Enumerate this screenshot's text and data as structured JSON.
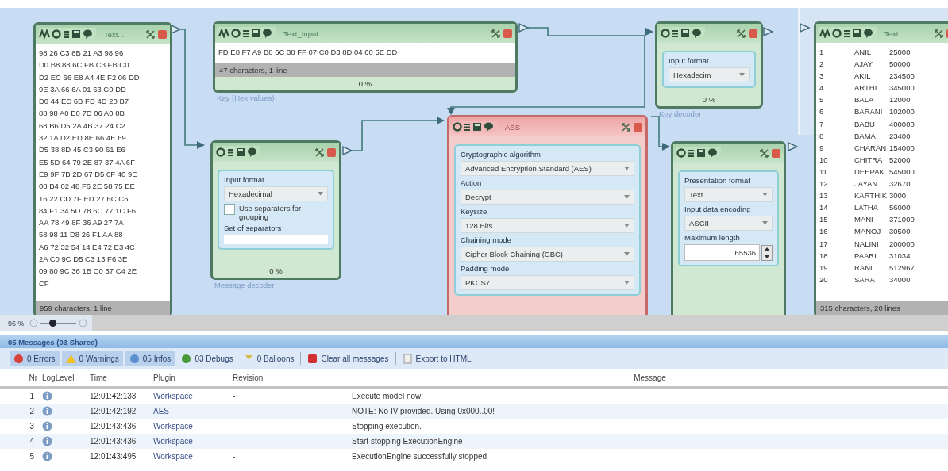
{
  "canvas": {
    "nodes": [
      {
        "kind": "text_box",
        "title": "Text...",
        "lines": [
          "98 26 C3 8B 21 A3 98 96",
          "D0 B8 88 6C FB C3 FB C0",
          "D2 EC 66 E8 A4 4E F2 06 DD",
          "9E 3A 66 6A 01 63 C0 DD",
          "D0 44 EC 6B FD 4D 20 B7",
          "88 98 A0 E0 7D 06 A0 8B",
          "68 B6 D5 2A 4B 37 24 C2",
          "32 1A D2 ED 8E 66 4E 69",
          "D5 38 8D 45 C3 90 61 E6",
          "E5 5D 64 79 2E 87 37 4A 6F",
          "E9 9F 7B 2D 67 D5 0F 40 9E",
          "08 B4 02 48 F6 2E 58 75 EE",
          "16 22 CD 7F ED 27 6C C6",
          "84 F1 34 5D 78 6C 77 1C F6",
          "AA 78 49 8F 36 A9 27 7A",
          "58 98 11 D8 26 F1 AA 88",
          "A6 72 32 54 14 E4 72 E3 4C",
          "2A C0 9C D5 C3 13 F6 3E",
          "09 80 9C 36 1B C0 37 C4 2E",
          "CF"
        ],
        "stats": "959 characters, 1 line"
      },
      {
        "kind": "text_box",
        "title": "Text_Input",
        "lines": [
          "FD E8 F7 A9 B8 6C 38 FF 07 C0 D3 8D 04 60 5E DD"
        ],
        "stats": "47 characters, 1 line",
        "progress": "0 %",
        "caption": "Key (Hex values)"
      },
      {
        "kind": "settings",
        "fields": [
          {
            "kind": "label",
            "text": "Input format"
          },
          {
            "kind": "dropdown",
            "value": "Hexadecimal"
          },
          {
            "kind": "checkbox",
            "label": "Use separators for grouping",
            "checked": false
          },
          {
            "kind": "label",
            "text": "Set of separators"
          },
          {
            "kind": "textbox"
          }
        ],
        "progress": "0 %",
        "caption": "Message decoder"
      },
      {
        "kind": "settings",
        "error": true,
        "title": "AES",
        "fields": [
          {
            "kind": "label",
            "text": "Cryptographic algorithm"
          },
          {
            "kind": "dropdown",
            "value": "Advanced Encryption Standard (AES)"
          },
          {
            "kind": "label",
            "text": "Action"
          },
          {
            "kind": "dropdown",
            "value": "Decrypt"
          },
          {
            "kind": "label",
            "text": "Keysize"
          },
          {
            "kind": "dropdown",
            "value": "128 Bits"
          },
          {
            "kind": "label",
            "text": "Chaining mode"
          },
          {
            "kind": "dropdown",
            "value": "Cipher Block Chaining (CBC)"
          },
          {
            "kind": "label",
            "text": "Padding mode"
          },
          {
            "kind": "dropdown",
            "value": "PKCS7"
          }
        ]
      },
      {
        "kind": "settings",
        "fields": [
          {
            "kind": "label",
            "text": "Input format"
          },
          {
            "kind": "dropdown",
            "value": "Hexadecim"
          }
        ],
        "progress": "0 %",
        "caption": "Key decoder"
      },
      {
        "kind": "settings",
        "fields": [
          {
            "kind": "label",
            "text": "Presentation format"
          },
          {
            "kind": "dropdown",
            "value": "Text"
          },
          {
            "kind": "label",
            "text": "Input data encoding"
          },
          {
            "kind": "dropdown",
            "value": "ASCII"
          },
          {
            "kind": "label",
            "text": "Maximum length"
          },
          {
            "kind": "number",
            "value": "65536"
          }
        ]
      },
      {
        "kind": "table_text",
        "title": "Text...",
        "rows": [
          {
            "n": "1",
            "name": "ANIL",
            "value": "25000"
          },
          {
            "n": "2",
            "name": "AJAY",
            "value": "50000"
          },
          {
            "n": "3",
            "name": "AKIL",
            "value": "234500"
          },
          {
            "n": "4",
            "name": "ARTHI",
            "value": "345000"
          },
          {
            "n": "5",
            "name": "BALA",
            "value": "12000"
          },
          {
            "n": "6",
            "name": "BARANI",
            "value": "102000"
          },
          {
            "n": "7",
            "name": "BABU",
            "value": "400000"
          },
          {
            "n": "8",
            "name": "BAMA",
            "value": "23400"
          },
          {
            "n": "9",
            "name": "CHARAN",
            "value": "154000"
          },
          {
            "n": "10",
            "name": "CHITRA",
            "value": "52000"
          },
          {
            "n": "11",
            "name": "DEEPAK",
            "value": "545000"
          },
          {
            "n": "12",
            "name": "JAYAN",
            "value": "32670"
          },
          {
            "n": "13",
            "name": "KARTHIK",
            "value": "3000"
          },
          {
            "n": "14",
            "name": "LATHA",
            "value": "56000"
          },
          {
            "n": "15",
            "name": "MANI",
            "value": "371000"
          },
          {
            "n": "16",
            "name": "MANOJ",
            "value": "30500"
          },
          {
            "n": "17",
            "name": "NALINI",
            "value": "200000"
          },
          {
            "n": "18",
            "name": "PAARI",
            "value": "31034"
          },
          {
            "n": "19",
            "name": "RANI",
            "value": "512967"
          },
          {
            "n": "20",
            "name": "SARA",
            "value": "34000"
          }
        ],
        "stats": "315 characters, 20 lines"
      }
    ]
  },
  "zoom": {
    "label": "96 %",
    "level": 0.35
  },
  "messages": {
    "title": "05 Messages (03 Shared)",
    "filters": [
      {
        "kind": "error",
        "label": "0 Errors",
        "selected": true
      },
      {
        "kind": "warning",
        "label": "0 Warnings",
        "selected": true
      },
      {
        "kind": "info",
        "label": "05 Infos",
        "selected": true
      },
      {
        "kind": "debug",
        "label": "03 Debugs",
        "selected": false
      },
      {
        "kind": "balloon",
        "label": "0 Balloons",
        "selected": false
      }
    ],
    "actions": [
      {
        "kind": "clear",
        "label": "Clear all messages"
      },
      {
        "kind": "export",
        "label": "Export to HTML"
      }
    ],
    "columns": [
      "Nr",
      "LogLevel",
      "Time",
      "Plugin",
      "Revision",
      "Message"
    ],
    "rows": [
      {
        "nr": "1",
        "kind": "info",
        "time": "12:01:42:133",
        "plugin": "Workspace",
        "revision": "-",
        "message": "Execute model now!"
      },
      {
        "nr": "2",
        "kind": "info",
        "time": "12:01:42:192",
        "plugin": "AES",
        "message": "NOTE: No IV provided. Using 0x000..00!"
      },
      {
        "nr": "3",
        "kind": "info",
        "time": "12:01:43:436",
        "plugin": "Workspace",
        "revision": "-",
        "message": "Stopping execution."
      },
      {
        "nr": "4",
        "kind": "info",
        "time": "12:01:43:436",
        "plugin": "Workspace",
        "revision": "-",
        "message": "Start stopping ExecutionEngine"
      },
      {
        "nr": "5",
        "kind": "info",
        "time": "12:01:43:495",
        "plugin": "Workspace",
        "revision": "-",
        "message": "ExecutionEngine successfully stopped"
      }
    ]
  }
}
